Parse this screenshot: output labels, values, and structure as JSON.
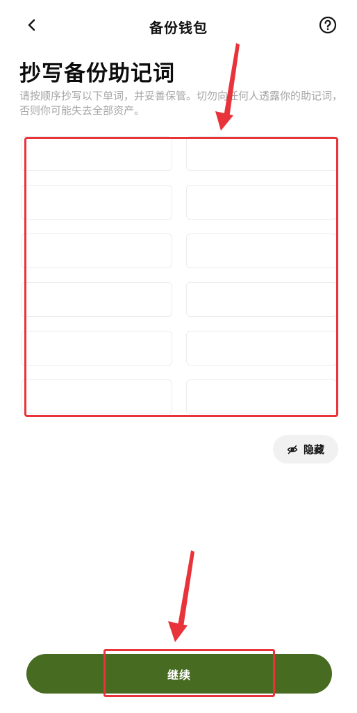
{
  "header": {
    "title": "备份钱包",
    "back_icon": "chevron-left-icon",
    "help_icon": "question-circle-icon"
  },
  "page": {
    "title": "抄写备份助记词",
    "subtitle": "请按顺序抄写以下单词，并妥善保管。切勿向任何人透露你的助记词，否则你可能失去全部资产。"
  },
  "mnemonic": {
    "words": [
      "",
      "",
      "",
      "",
      "",
      "",
      "",
      "",
      "",
      "",
      "",
      ""
    ]
  },
  "hide_button": {
    "label": "隐藏",
    "icon": "eye-off-icon"
  },
  "continue_button": {
    "label": "继续"
  },
  "colors": {
    "primary": "#486b22",
    "annotation": "#e8333a",
    "muted_text": "#a6a6a6"
  }
}
